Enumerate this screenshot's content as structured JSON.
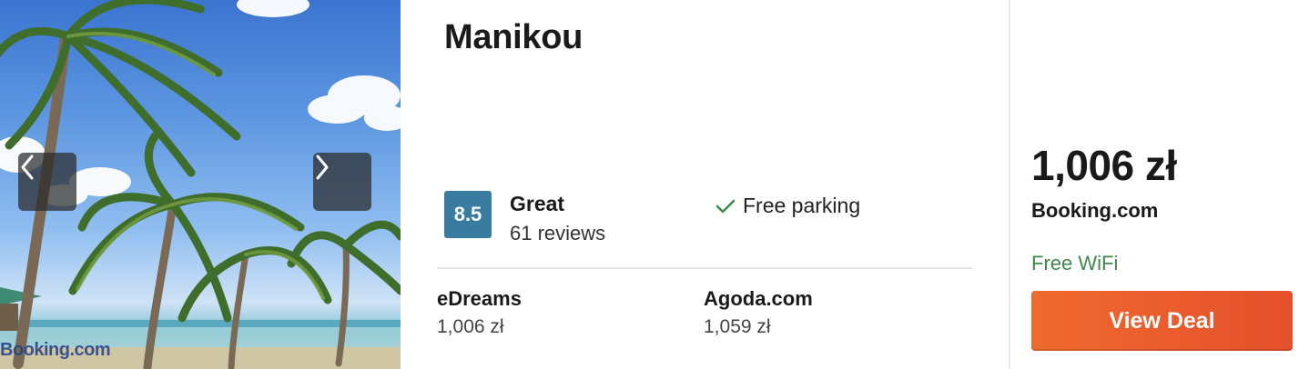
{
  "hotel": {
    "name": "Manikou",
    "image_watermark": "Booking.com",
    "rating": {
      "score": "8.5",
      "label": "Great",
      "reviews": "61 reviews",
      "badge_color": "#3a7ba0"
    },
    "amenity": "Free parking"
  },
  "alternatives": [
    {
      "provider": "eDreams",
      "price": "1,006 zł"
    },
    {
      "provider": "Agoda.com",
      "price": "1,059 zł"
    }
  ],
  "deal": {
    "price": "1,006 zł",
    "provider": "Booking.com",
    "feature": "Free WiFi",
    "button_label": "View Deal",
    "button_color": "#e85a2c",
    "feature_color": "#3d8a4c"
  },
  "icons": {
    "prev": "chevron-left-icon",
    "next": "chevron-right-icon",
    "amenity": "checkmark-icon"
  }
}
